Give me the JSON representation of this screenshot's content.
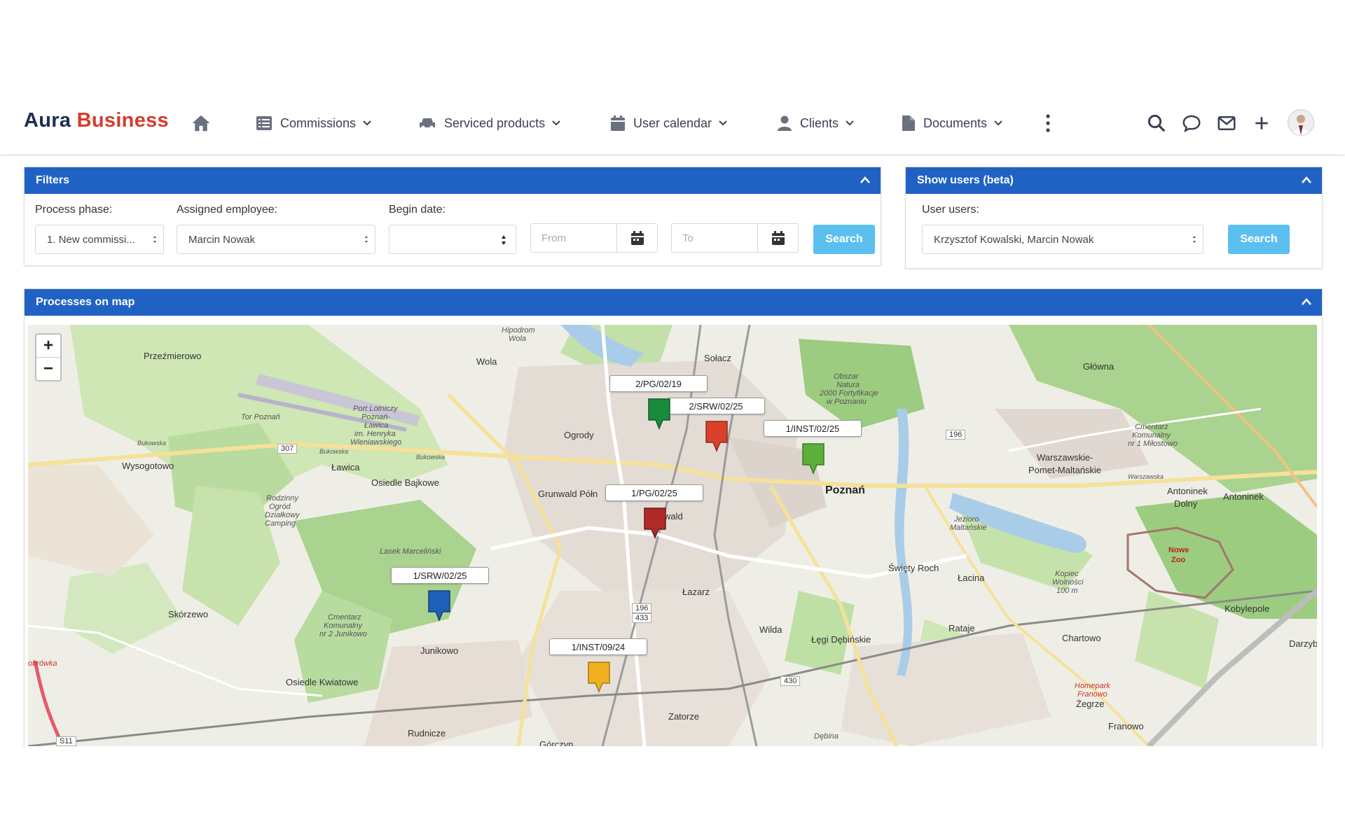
{
  "brand": {
    "part1": "Aura",
    "part2": "Business"
  },
  "nav": {
    "items": [
      {
        "label": "Commissions",
        "icon": "list-icon"
      },
      {
        "label": "Serviced products",
        "icon": "car-icon"
      },
      {
        "label": "User calendar",
        "icon": "calendar-icon"
      },
      {
        "label": "Clients",
        "icon": "user-icon"
      },
      {
        "label": "Documents",
        "icon": "document-icon"
      }
    ]
  },
  "filters": {
    "title": "Filters",
    "process_phase_label": "Process phase:",
    "process_phase_value": "1. New commissi...",
    "assigned_employee_label": "Assigned employee:",
    "assigned_employee_value": "Marcin Nowak",
    "begin_date_label": "Begin date:",
    "begin_date_value": "",
    "from_placeholder": "From",
    "to_placeholder": "To",
    "search_label": "Search"
  },
  "users_panel": {
    "title": "Show users (beta)",
    "user_users_label": "User users:",
    "user_users_value": "Krzysztof Kowalski, Marcin Nowak",
    "search_label": "Search"
  },
  "map_panel": {
    "title": "Processes on map",
    "zoom_in": "+",
    "zoom_out": "−",
    "markers": [
      {
        "label": "2/PG/02/19",
        "color": "#1a8a3c"
      },
      {
        "label": "2/SRW/02/25",
        "color": "#d9402b"
      },
      {
        "label": "1/INST/02/25",
        "color": "#5cb03a"
      },
      {
        "label": "1/PG/02/25",
        "color": "#b02a2a"
      },
      {
        "label": "1/SRW/02/25",
        "color": "#1f5fb8"
      },
      {
        "label": "1/INST/09/24",
        "color": "#f0b020"
      }
    ],
    "places": {
      "przezmierowo": "Przeźmierowo",
      "wola": "Wola",
      "solacz": "Sołacz",
      "glowna": "Główna",
      "ogrody": "Ogrody",
      "wysogotowo": "Wysogotowo",
      "lawica": "Ławica",
      "osiedle_bajkowe": "Osiedle Bajkowe",
      "grunwald": "Grunwald Półn",
      "wald": "wald",
      "poznan": "Poznań",
      "warszawskie": "Warszawskie-",
      "pomet": "Pomet-Maltańskie",
      "antoninek_dolny": "Antoninek",
      "dolny": "Dolny",
      "antoninek": "Antoninek",
      "skorzewo": "Skórzewo",
      "lazarz": "Łazarz",
      "swiety_roch": "Święty Roch",
      "lacina": "Łacina",
      "rataje": "Rataje",
      "chartowo": "Chartowo",
      "kobylepole": "Kobylepole",
      "junikowo": "Junikowo",
      "wilda": "Wilda",
      "legi": "Łęgi Dębińskie",
      "osiedle_kwiatowe": "Osiedle Kwiatowe",
      "zatorze": "Zatorze",
      "zegrze": "Żegrze",
      "franowo": "Franowo",
      "rudnicze": "Rudnicze",
      "gorczyn": "Górczyn",
      "darzybor": "Darzybo",
      "nowe_zoo": "Nowe",
      "zoo": "Zoo",
      "hipodrom": "Hipodrom",
      "hipodrom2": "Wola",
      "tor": "Tor Poznań",
      "port1": "Port Lotniczy",
      "port2": "Poznań-",
      "port3": "Ławica",
      "port4": "im. Henryka",
      "port5": "Wieniawskiego",
      "lasek": "Lasek Marceliński",
      "rodzinny1": "Rodzinny",
      "rodzinny2": "Ogród",
      "rodzinny3": "Działkowy",
      "rodzinny4": "Camping",
      "cmentarz1": "Cmentarz",
      "cmentarz2": "Komunalny",
      "cmentarz3": "nr 2 Junikowo",
      "cmentarz4": "Cmentarz",
      "cmentarz5": "Komunalny",
      "cmentarz6": "nr 1 Miłostowo",
      "obszar1": "Obszar",
      "obszar2": "Natura",
      "obszar3": "2000 Fortyfikacje",
      "obszar4": "w Poznaniu",
      "jezioro1": "Jezioro",
      "jezioro2": "Maltańskie",
      "kopiec1": "Kopiec",
      "kopiec2": "Wolności",
      "kopiec3": "100 m",
      "homepark1": "Homepark",
      "homepark2": "Franowo",
      "debina": "Dębina",
      "obrowka": "obrówka",
      "bukowska1": "Bukowska",
      "bukowska2": "Bukowska",
      "bukowska3": "Bukowska",
      "warszawska": "Warszawska",
      "road_307": "307",
      "road_196": "196",
      "road_196b": "196",
      "road_433": "433",
      "road_430": "430",
      "road_s11": "S11"
    }
  }
}
